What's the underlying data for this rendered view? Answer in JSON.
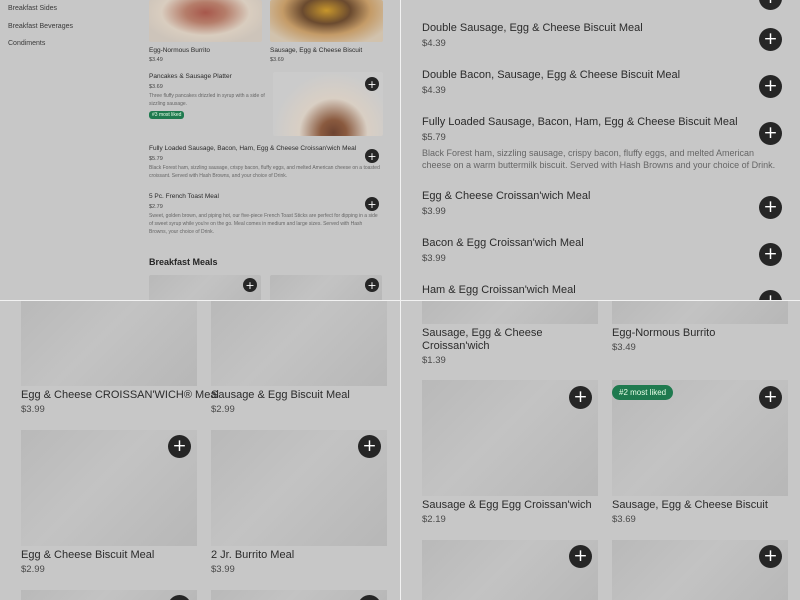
{
  "q1": {
    "sidebar": [
      "Breakfast Sides",
      "Breakfast Beverages",
      "Condiments"
    ],
    "top_cards": [
      {
        "name": "Egg-Normous Burrito",
        "price": "$3.49"
      },
      {
        "name": "Sausage, Egg & Cheese Biscuit",
        "price": "$3.69"
      }
    ],
    "items": [
      {
        "name": "Pancakes & Sausage Platter",
        "price": "$3.69",
        "desc": "Three fluffy pancakes drizzled in syrup with a side of sizzling sausage.",
        "badge": "#3 most liked"
      },
      {
        "name": "Fully Loaded Sausage, Bacon, Ham, Egg & Cheese Croissan'wich Meal",
        "price": "$5.79",
        "desc": "Black Forest ham, sizzling sausage, crispy bacon, fluffy eggs, and melted American cheese on a toasted croissant. Served with Hash Browns, and your choice of Drink."
      },
      {
        "name": "5 Pc. French Toast Meal",
        "price": "$2.79",
        "desc": "Sweet, golden brown, and piping hot, our five-piece French Toast Sticks are perfect for dipping in a side of sweet syrup while you're on the go. Meal comes in medium and large sizes. Served with Hash Browns, your choice of Drink."
      }
    ],
    "section_title": "Breakfast Meals",
    "add_symbol": "+"
  },
  "q2": {
    "items": [
      {
        "name": "Double Sausage, Egg & Cheese Biscuit Meal",
        "price": "$4.39"
      },
      {
        "name": "Double Bacon, Sausage, Egg & Cheese Biscuit Meal",
        "price": "$4.39"
      },
      {
        "name": "Fully Loaded Sausage, Bacon, Ham, Egg & Cheese Biscuit Meal",
        "price": "$5.79",
        "desc": "Black Forest ham, sizzling sausage, crispy bacon, fluffy eggs, and melted American cheese on a warm buttermilk biscuit. Served with Hash Browns and your choice of Drink."
      },
      {
        "name": "Egg & Cheese Croissan'wich Meal",
        "price": "$3.99"
      },
      {
        "name": "Bacon & Egg Croissan'wich Meal",
        "price": "$3.99"
      },
      {
        "name": "Ham & Egg Croissan'wich Meal",
        "price": ""
      }
    ]
  },
  "q3": {
    "cards": [
      {
        "name": "Egg & Cheese CROISSAN'WICH® Meal",
        "price": "$3.99"
      },
      {
        "name": "Sausage & Egg Biscuit Meal",
        "price": "$2.99"
      },
      {
        "name": "Egg & Cheese Biscuit Meal",
        "price": "$2.99"
      },
      {
        "name": "2 Jr. Burrito Meal",
        "price": "$3.99"
      }
    ]
  },
  "q4": {
    "cards": [
      {
        "name": "Sausage, Egg & Cheese Croissan'wich",
        "price": "$1.39"
      },
      {
        "name": "Egg-Normous Burrito",
        "price": "$3.49"
      },
      {
        "name": "Sausage & Egg Egg Croissan'wich",
        "price": "$2.19"
      },
      {
        "name": "Sausage, Egg & Cheese Biscuit",
        "price": "$3.69",
        "badge": "#2 most liked"
      }
    ]
  },
  "colors": {
    "accent_badge": "#1f7a4f",
    "add_button": "#262626",
    "overlay": "#c7c7c7"
  },
  "icons": {
    "add": "plus-icon"
  }
}
